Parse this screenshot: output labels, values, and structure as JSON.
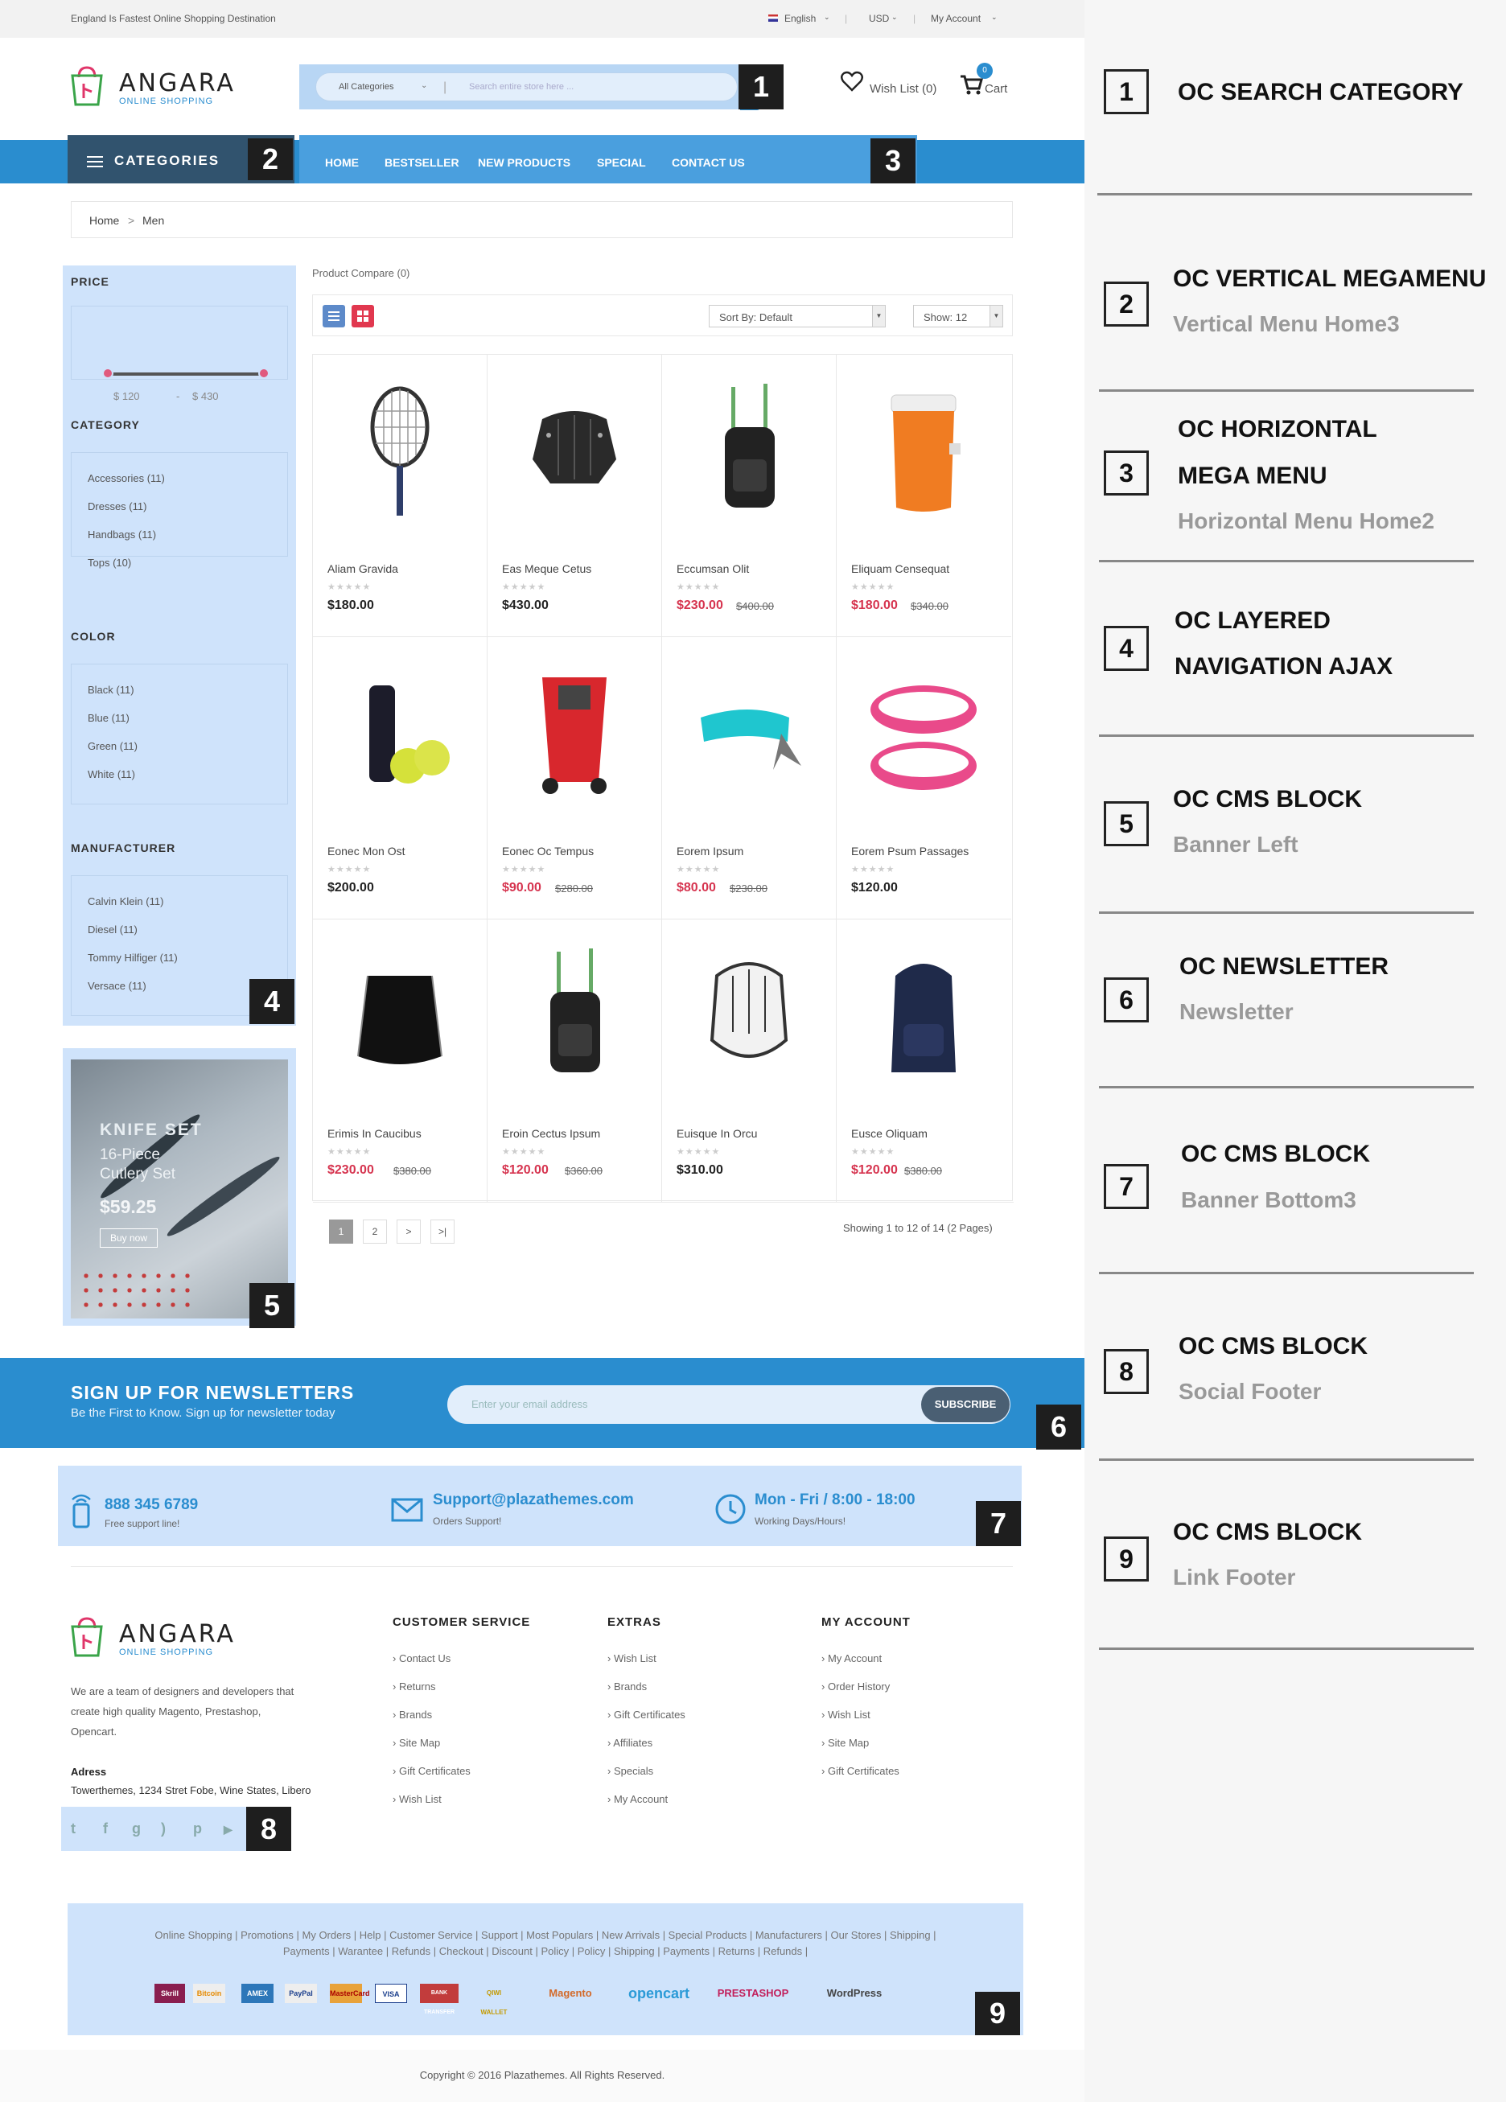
{
  "topbar": {
    "tagline": "England Is Fastest Online Shopping Destination",
    "language": "English",
    "currency": "USD",
    "account": "My Account"
  },
  "logo": {
    "name": "ANGARA",
    "sub": "ONLINE SHOPPING"
  },
  "search": {
    "category": "All Categories",
    "placeholder": "Search entire store here ...",
    "marker": "1"
  },
  "header": {
    "wishlist": "Wish List (0)",
    "cart": "Cart",
    "cart_count": "0"
  },
  "vertical_menu": {
    "label": "CATEGORIES",
    "marker": "2"
  },
  "horizontal_menu": {
    "items": [
      "HOME",
      "BESTSELLER",
      "NEW PRODUCTS",
      "SPECIAL",
      "CONTACT US"
    ],
    "marker": "3"
  },
  "breadcrumb": {
    "home": "Home",
    "sep": ">",
    "current": "Men"
  },
  "filters": {
    "price_heading": "PRICE",
    "price_min": "$ 120",
    "price_dash": "-",
    "price_max": "$ 430",
    "category_heading": "CATEGORY",
    "categories": [
      "Accessories (11)",
      "Dresses (11)",
      "Handbags (11)",
      "Tops (10)"
    ],
    "color_heading": "COLOR",
    "colors": [
      "Black (11)",
      "Blue (11)",
      "Green (11)",
      "White (11)"
    ],
    "manufacturer_heading": "MANUFACTURER",
    "manufacturers": [
      "Calvin Klein (11)",
      "Diesel (11)",
      "Tommy Hilfiger (11)",
      "Versace (11)"
    ],
    "marker": "4"
  },
  "banner_left": {
    "title": "KNIFE SET",
    "line1": "16-Piece",
    "line2": "Cutlery Set",
    "price": "$59.25",
    "button": "Buy now",
    "marker": "5"
  },
  "toolbar": {
    "compare": "Product Compare (0)",
    "sort": "Sort By: Default",
    "show": "Show: 12"
  },
  "products": [
    {
      "name": "Aliam Gravida",
      "price": "$180.00",
      "old": ""
    },
    {
      "name": "Eas Meque Cetus",
      "price": "$430.00",
      "old": ""
    },
    {
      "name": "Eccumsan Olit",
      "price": "$230.00",
      "old": "$400.00"
    },
    {
      "name": "Eliquam Censequat",
      "price": "$180.00",
      "old": "$340.00"
    },
    {
      "name": "Eonec Mon Ost",
      "price": "$200.00",
      "old": ""
    },
    {
      "name": "Eonec Oc Tempus",
      "price": "$90.00",
      "old": "$280.00"
    },
    {
      "name": "Eorem Ipsum",
      "price": "$80.00",
      "old": "$230.00"
    },
    {
      "name": "Eorem Psum Passages",
      "price": "$120.00",
      "old": ""
    },
    {
      "name": "Erimis In Caucibus",
      "price": "$230.00",
      "old": "$380.00"
    },
    {
      "name": "Eroin Cectus Ipsum",
      "price": "$120.00",
      "old": "$360.00"
    },
    {
      "name": "Euisque In Orcu",
      "price": "$310.00",
      "old": ""
    },
    {
      "name": "Eusce Oliquam",
      "price": "$120.00",
      "old": "$380.00"
    }
  ],
  "pagination": {
    "pages": [
      "1",
      "2",
      ">",
      ">|"
    ],
    "showing": "Showing 1 to 12 of 14 (2 Pages)"
  },
  "newsletter": {
    "title": "SIGN UP FOR NEWSLETTERS",
    "subtitle": "Be the First to Know. Sign up for newsletter today",
    "placeholder": "Enter your email address",
    "button": "SUBSCRIBE",
    "marker": "6"
  },
  "contact": {
    "phone": "888 345 6789",
    "phone_sub": "Free support line!",
    "email": "Support@plazathemes.com",
    "email_sub": "Orders Support!",
    "hours": "Mon - Fri / 8:00 - 18:00",
    "hours_sub": "Working Days/Hours!",
    "marker": "7"
  },
  "footer": {
    "about": [
      "We are a team of designers and developers that",
      "create high quality Magento, Prestashop,",
      "Opencart."
    ],
    "address_label": "Adress",
    "address": "Towerthemes, 1234 Stret Fobe, Wine States, Libero",
    "social_marker": "8",
    "columns": [
      {
        "title": "CUSTOMER SERVICE",
        "links": [
          "Contact Us",
          "Returns",
          "Brands",
          "Site Map",
          "Gift Certificates",
          "Wish List"
        ]
      },
      {
        "title": "EXTRAS",
        "links": [
          "Wish List",
          "Brands",
          "Gift Certificates",
          "Affiliates",
          "Specials",
          "My Account"
        ]
      },
      {
        "title": "MY ACCOUNT",
        "links": [
          "My Account",
          "Order History",
          "Wish List",
          "Site Map",
          "Gift Certificates"
        ]
      }
    ]
  },
  "link_footer": {
    "line1": "Online Shopping | Promotions | My Orders | Help | Customer Service | Support | Most Populars | New Arrivals | Special Products | Manufacturers | Our Stores | Shipping |",
    "line2": "Payments | Warantee | Refunds | Checkout | Discount | Policy | Policy | Shipping | Payments | Returns | Refunds |",
    "payments": [
      "Skrill",
      "Bitcoin",
      "AMEX",
      "PayPal",
      "MasterCard",
      "VISA",
      "BANK TRANSFER",
      "QIWI WALLET",
      "Magento",
      "opencart",
      "PRESTASHOP",
      "WordPress"
    ],
    "marker": "9"
  },
  "copyright": "Copyright © 2016 Plazathemes. All Rights Reserved.",
  "legend": [
    {
      "num": "1",
      "title": "OC SEARCH CATEGORY",
      "sub": ""
    },
    {
      "num": "2",
      "title": "OC VERTICAL MEGAMENU",
      "sub": "Vertical Menu Home3"
    },
    {
      "num": "3",
      "title": "OC HORIZONTAL",
      "title2": "MEGA MENU",
      "sub": "Horizontal Menu Home2"
    },
    {
      "num": "4",
      "title": "OC LAYERED",
      "title2": "NAVIGATION AJAX",
      "sub": ""
    },
    {
      "num": "5",
      "title": "OC CMS BLOCK",
      "sub": "Banner Left"
    },
    {
      "num": "6",
      "title": "OC NEWSLETTER",
      "sub": "Newsletter"
    },
    {
      "num": "7",
      "title": "OC CMS BLOCK",
      "sub": "Banner Bottom3"
    },
    {
      "num": "8",
      "title": "OC CMS BLOCK",
      "sub": "Social Footer"
    },
    {
      "num": "9",
      "title": "OC CMS BLOCK",
      "sub": "Link Footer"
    }
  ]
}
